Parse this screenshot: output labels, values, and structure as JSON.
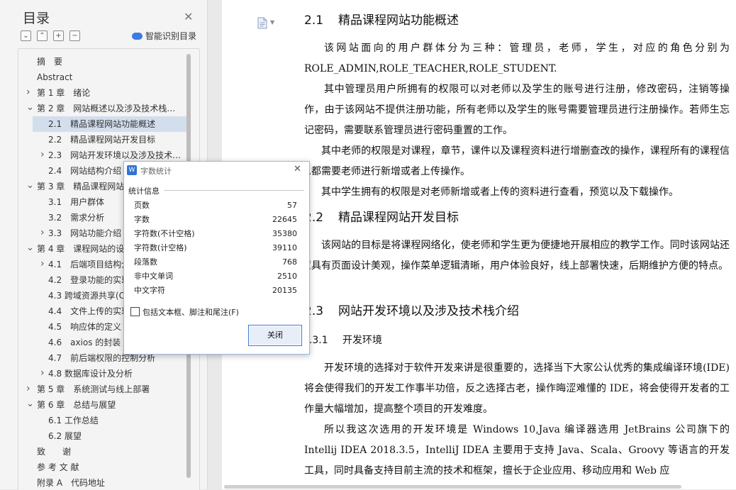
{
  "nav": {
    "title": "目录",
    "smart_toc_label": "智能识别目录",
    "toolbar_icons": [
      "collapse-all-icon",
      "expand-all-icon",
      "add-heading-icon",
      "remove-heading-icon"
    ],
    "items": [
      {
        "label": "摘　要",
        "level": 0,
        "expander": "none"
      },
      {
        "label": "Abstract",
        "level": 0,
        "expander": "none"
      },
      {
        "label": "第 1 章　绪论",
        "level": 0,
        "expander": "collapsed"
      },
      {
        "label": "第 2 章　网站概述以及涉及技术栈…",
        "level": 0,
        "expander": "expanded"
      },
      {
        "label": "2.1　精品课程网站功能概述",
        "level": 1,
        "expander": "none",
        "selected": true
      },
      {
        "label": "2.2　精品课程网站开发目标",
        "level": 1,
        "expander": "none"
      },
      {
        "label": "2.3　网站开发环境以及涉及技术…",
        "level": 1,
        "expander": "collapsed"
      },
      {
        "label": "2.4　网站结构介绍",
        "level": 1,
        "expander": "none"
      },
      {
        "label": "第 3 章　精品课程网站",
        "level": 0,
        "expander": "expanded"
      },
      {
        "label": "3.1　用户群体",
        "level": 1,
        "expander": "none"
      },
      {
        "label": "3.2　需求分析",
        "level": 1,
        "expander": "none"
      },
      {
        "label": "3.3　网站功能介绍",
        "level": 1,
        "expander": "collapsed"
      },
      {
        "label": "第 4 章　课程网站的设",
        "level": 0,
        "expander": "expanded"
      },
      {
        "label": "4.1　后端项目结构介",
        "level": 1,
        "expander": "collapsed"
      },
      {
        "label": "4.2　登录功能的实现",
        "level": 1,
        "expander": "none"
      },
      {
        "label": "4.3 跨域资源共享(C",
        "level": 1,
        "expander": "none"
      },
      {
        "label": "4.4　文件上传的实现",
        "level": 1,
        "expander": "none"
      },
      {
        "label": "4.5　响应体的定义",
        "level": 1,
        "expander": "none"
      },
      {
        "label": "4.6　axios 的封装",
        "level": 1,
        "expander": "none"
      },
      {
        "label": "4.7　前后端权限的控制分析",
        "level": 1,
        "expander": "none"
      },
      {
        "label": "4.8 数据库设计及分析",
        "level": 1,
        "expander": "collapsed"
      },
      {
        "label": "第 5 章　系统测试与线上部署",
        "level": 0,
        "expander": "collapsed"
      },
      {
        "label": "第 6 章　总结与展望",
        "level": 0,
        "expander": "expanded"
      },
      {
        "label": "6.1 工作总结",
        "level": 1,
        "expander": "none"
      },
      {
        "label": "6.2 展望",
        "level": 1,
        "expander": "none"
      },
      {
        "label": "致　　谢",
        "level": 0,
        "expander": "none"
      },
      {
        "label": "参 考 文 献",
        "level": 0,
        "expander": "none"
      },
      {
        "label": "附录 A　代码地址",
        "level": 0,
        "expander": "none"
      }
    ]
  },
  "doc": {
    "sections": [
      {
        "kind": "h2",
        "number": "2.1",
        "title": "精品课程网站功能概述",
        "paragraphs": [
          {
            "text": "该网站面向的用户群体分为三种：管理员，老师，学生，对应的角色分别为ROLE_ADMIN,ROLE_TEACHER,ROLE_STUDENT."
          },
          {
            "text": "其中管理员用户所拥有的权限可以对老师以及学生的账号进行注册，修改密码，注销等操作，由于该网站不提供注册功能，所有老师以及学生的账号需要管理员进行注册操作。若师生忘记密码，需要联系管理员进行密码重置的工作。"
          },
          {
            "text": "其中老师的权限是对课程，章节，课件以及课程资料进行增删查改的操作，课程所有的课程信息都需要老师进行新增或者上传操作。"
          },
          {
            "text": "其中学生拥有的权限是对老师新增或者上传的资料进行查看，预览以及下载操作。"
          }
        ]
      },
      {
        "kind": "h2",
        "number": "2.2",
        "title": "精品课程网站开发目标",
        "paragraphs": [
          {
            "text": "该网站的目标是将课程网络化，使老师和学生更为便捷地开展相应的教学工作。同时该网站还应具有页面设计美观，操作菜单逻辑清晰，用户体验良好，线上部署快速，后期维护方便的特点。"
          }
        ]
      },
      {
        "kind": "h2",
        "number": "2.3",
        "title": "网站开发环境以及涉及技术栈介绍",
        "paragraphs": []
      },
      {
        "kind": "h3",
        "number": "2.3.1",
        "title": "开发环境",
        "paragraphs": [
          {
            "text": "开发环境的选择对于软件开发来讲是很重要的，选择当下大家公认优秀的集成编译环境(IDE)将会使得我们的开发工作事半功倍，反之选择古老，操作晦涩难懂的 IDE，将会使得开发者的工作量大幅增加，提高整个项目的开发难度。"
          },
          {
            "text": "所以我这次选用的开发环境是 Windows 10,Java 编译器选用 JetBrains 公司旗下的 Intellij IDEA 2018.3.5，IntelliJ IDEA 主要用于支持 Java、Scala、Groovy 等语言的开发工具，同时具备支持目前主流的技术和框架，擅长于企业应用、移动应用和 Web 应"
          }
        ]
      }
    ]
  },
  "dialog": {
    "title": "字数统计",
    "section_label": "统计信息",
    "stats": [
      {
        "label": "页数",
        "value": "57"
      },
      {
        "label": "字数",
        "value": "22645"
      },
      {
        "label": "字符数(不计空格)",
        "value": "35380"
      },
      {
        "label": "字符数(计空格)",
        "value": "39110"
      },
      {
        "label": "段落数",
        "value": "768"
      },
      {
        "label": "非中文单词",
        "value": "2510"
      },
      {
        "label": "中文字符",
        "value": "20135"
      }
    ],
    "checkbox_label": "包括文本框、脚注和尾注(F)",
    "checkbox_checked": false,
    "close_button_label": "关闭"
  },
  "colors": {
    "selection": "#d3deed",
    "accent": "#3d7bd9",
    "nav_bg": "#f4f4f4",
    "page_bg": "#ffffff"
  }
}
